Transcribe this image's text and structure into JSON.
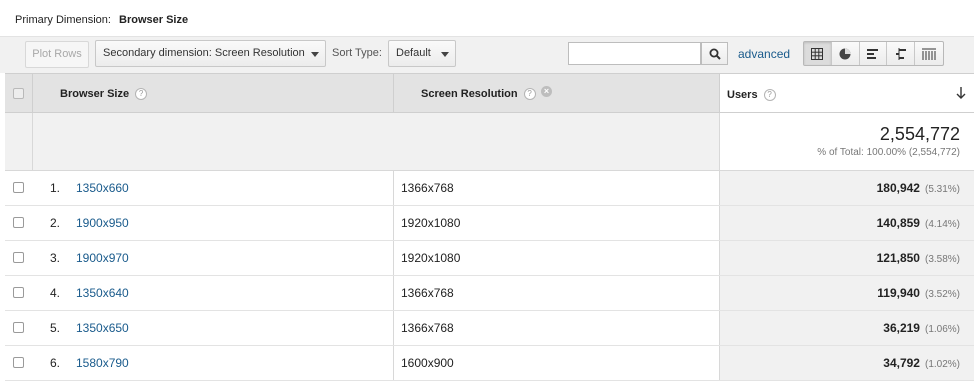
{
  "primary": {
    "label": "Primary Dimension:",
    "value": "Browser Size"
  },
  "toolbar": {
    "plot_rows": "Plot Rows",
    "secondary_dimension": "Secondary dimension: Screen Resolution",
    "sort_type_label": "Sort Type:",
    "sort_type_value": "Default",
    "search_value": "",
    "advanced": "advanced",
    "view_icons": [
      "data-table-icon",
      "pie-chart-icon",
      "performance-icon",
      "comparison-icon",
      "pivot-icon"
    ]
  },
  "table": {
    "headers": {
      "dim1": "Browser Size",
      "dim2": "Screen Resolution",
      "users": "Users",
      "help": "?"
    },
    "total": {
      "value": "2,554,772",
      "pct": "% of Total: 100.00% (2,554,772)"
    },
    "rows": [
      {
        "num": "1.",
        "dim1": "1350x660",
        "dim2": "1366x768",
        "users": "180,942",
        "pct": "(5.31%)"
      },
      {
        "num": "2.",
        "dim1": "1900x950",
        "dim2": "1920x1080",
        "users": "140,859",
        "pct": "(4.14%)"
      },
      {
        "num": "3.",
        "dim1": "1900x970",
        "dim2": "1920x1080",
        "users": "121,850",
        "pct": "(3.58%)"
      },
      {
        "num": "4.",
        "dim1": "1350x640",
        "dim2": "1366x768",
        "users": "119,940",
        "pct": "(3.52%)"
      },
      {
        "num": "5.",
        "dim1": "1350x650",
        "dim2": "1366x768",
        "users": "36,219",
        "pct": "(1.06%)"
      },
      {
        "num": "6.",
        "dim1": "1580x790",
        "dim2": "1600x900",
        "users": "34,792",
        "pct": "(1.02%)"
      }
    ]
  },
  "colors": {
    "link": "#1a5b8c",
    "header_bg": "#e3e3e3",
    "toolbar_bg": "#f1f1f1"
  }
}
